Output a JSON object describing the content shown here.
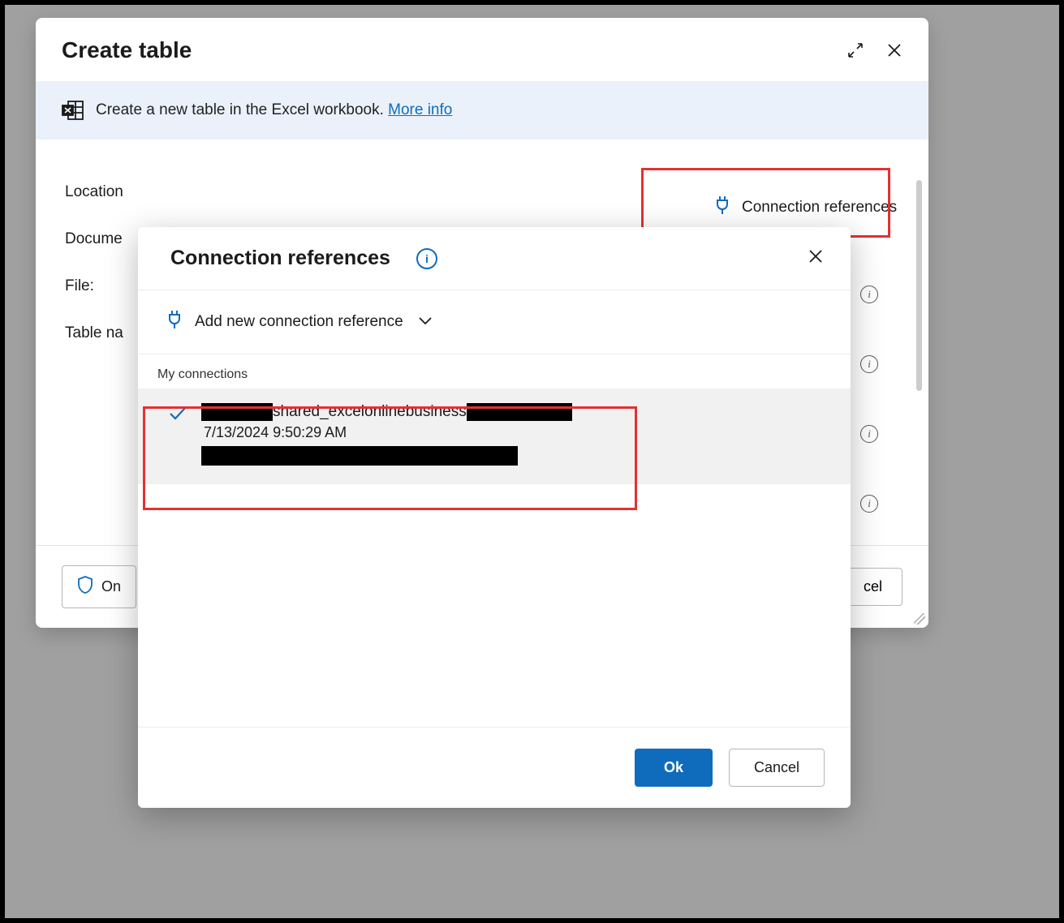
{
  "dialog": {
    "title": "Create table",
    "info_text": "Create a new table in the Excel workbook. ",
    "more_info": "More info",
    "conn_ref_btn": "Connection references",
    "fields": {
      "location": "Location",
      "document": "Docume",
      "file": "File:",
      "table_name": "Table na"
    },
    "footer": {
      "on_label": "On",
      "cancel_label": "cel"
    }
  },
  "popup": {
    "title": "Connection references",
    "add_label": "Add new connection reference",
    "my_conn_label": "My connections",
    "connection": {
      "name_mid": "shared_excelonlinebusiness",
      "timestamp": "7/13/2024 9:50:29 AM"
    },
    "ok": "Ok",
    "cancel": "Cancel"
  }
}
